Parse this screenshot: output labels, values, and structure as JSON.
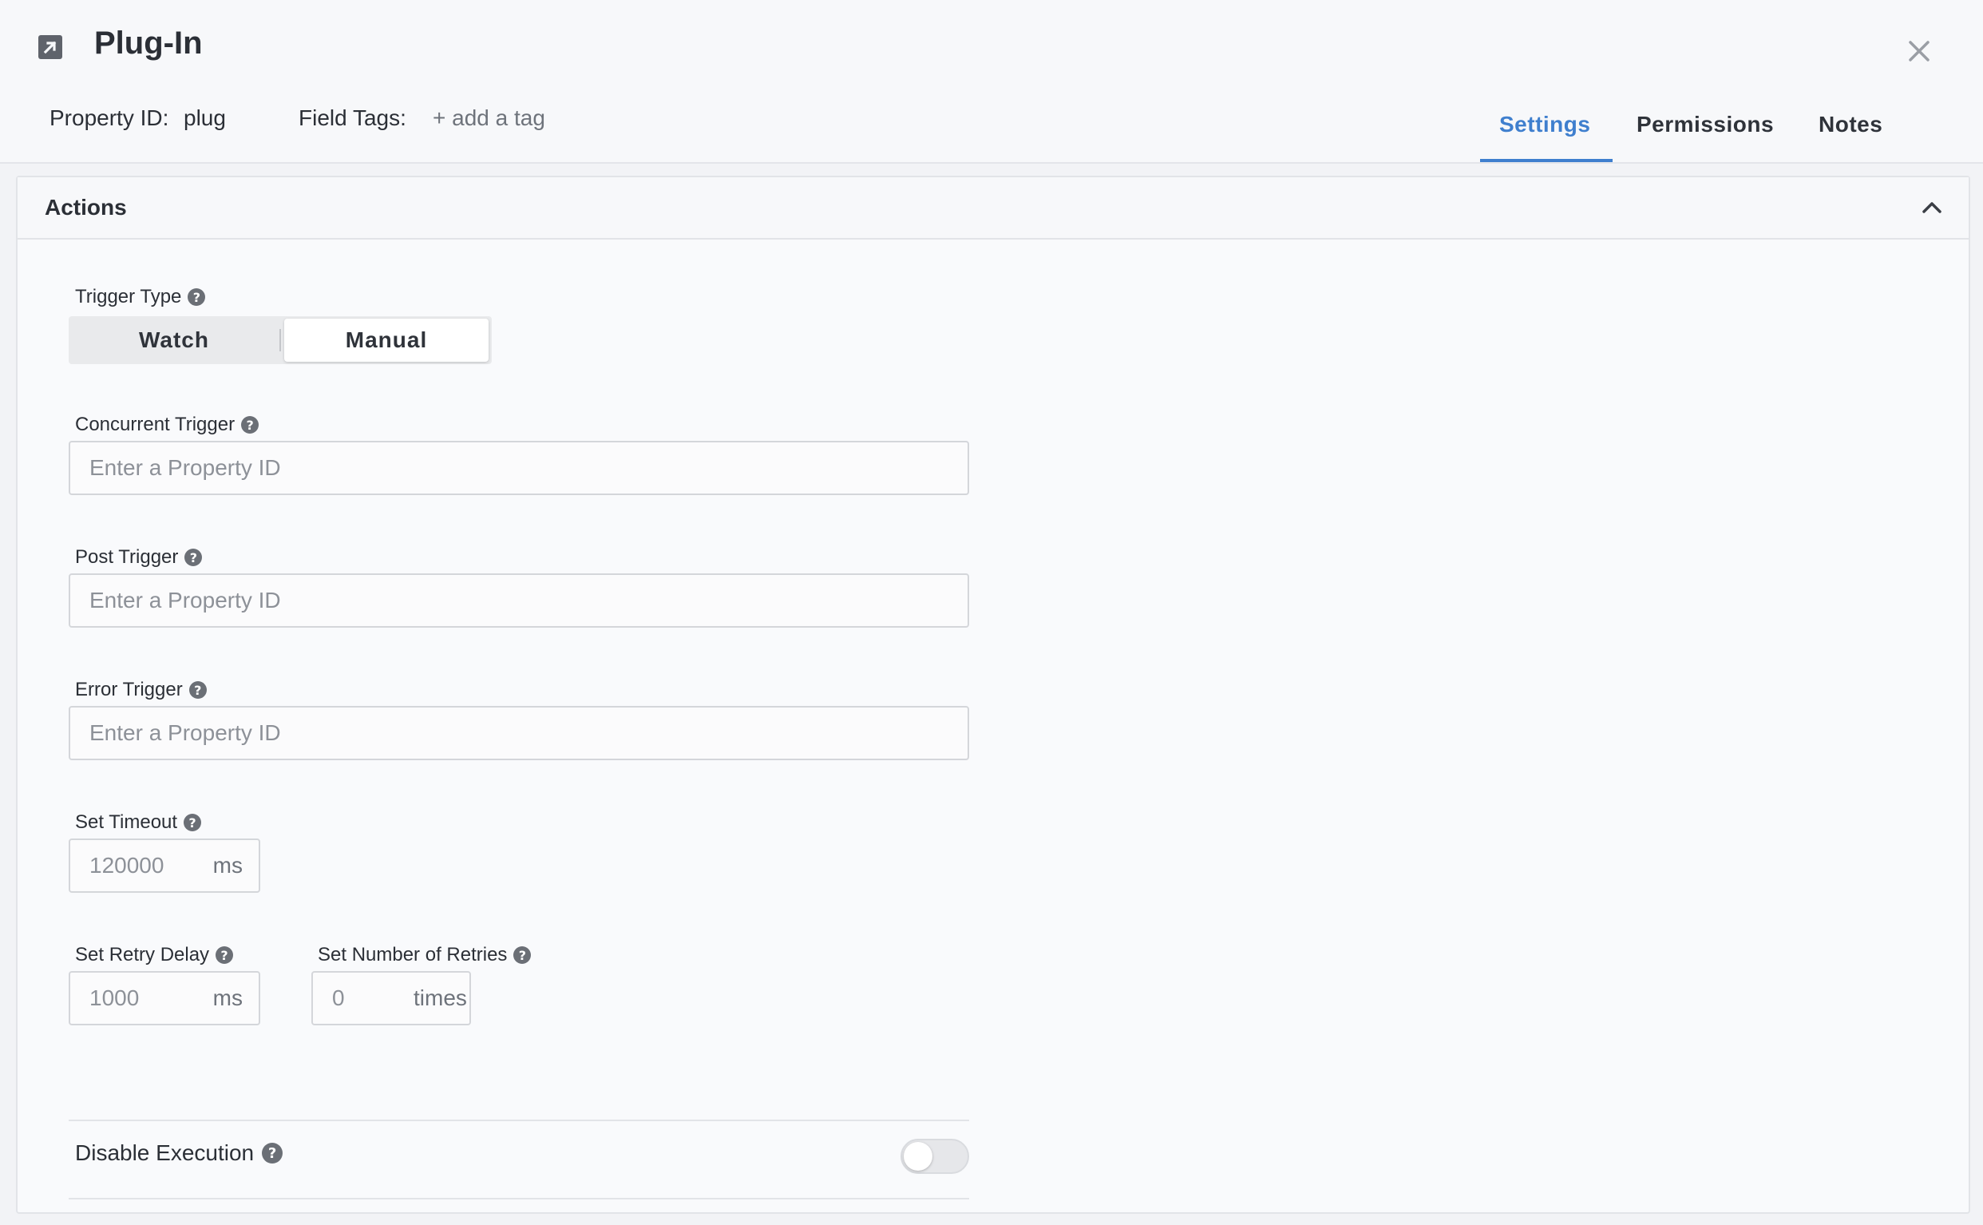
{
  "header": {
    "title": "Plug-In",
    "property_id_label": "Property ID:",
    "property_id_value": "plug",
    "field_tags_label": "Field Tags:",
    "add_tag_label": "+ add a tag",
    "tabs": [
      {
        "label": "Settings",
        "active": true
      },
      {
        "label": "Permissions",
        "active": false
      },
      {
        "label": "Notes",
        "active": false
      }
    ]
  },
  "panel": {
    "title": "Actions",
    "trigger_type": {
      "label": "Trigger Type",
      "options": [
        "Watch",
        "Manual"
      ],
      "selected": "Manual"
    },
    "concurrent_trigger": {
      "label": "Concurrent Trigger",
      "placeholder": "Enter a Property ID",
      "value": ""
    },
    "post_trigger": {
      "label": "Post Trigger",
      "placeholder": "Enter a Property ID",
      "value": ""
    },
    "error_trigger": {
      "label": "Error Trigger",
      "placeholder": "Enter a Property ID",
      "value": ""
    },
    "timeout": {
      "label": "Set Timeout",
      "placeholder": "120000",
      "unit": "ms"
    },
    "retry_delay": {
      "label": "Set Retry Delay",
      "placeholder": "1000",
      "unit": "ms"
    },
    "retries": {
      "label": "Set Number of Retries",
      "placeholder": "0",
      "unit": "times"
    },
    "disable_execution": {
      "label": "Disable Execution",
      "enabled": false
    }
  },
  "colors": {
    "accent": "#3f7fce",
    "text": "#2b2f36",
    "muted": "#8d9198"
  },
  "icons": {
    "plugin": "external-link-icon",
    "close": "close-icon",
    "collapse": "chevron-up-icon",
    "help": "question-circle-icon"
  }
}
